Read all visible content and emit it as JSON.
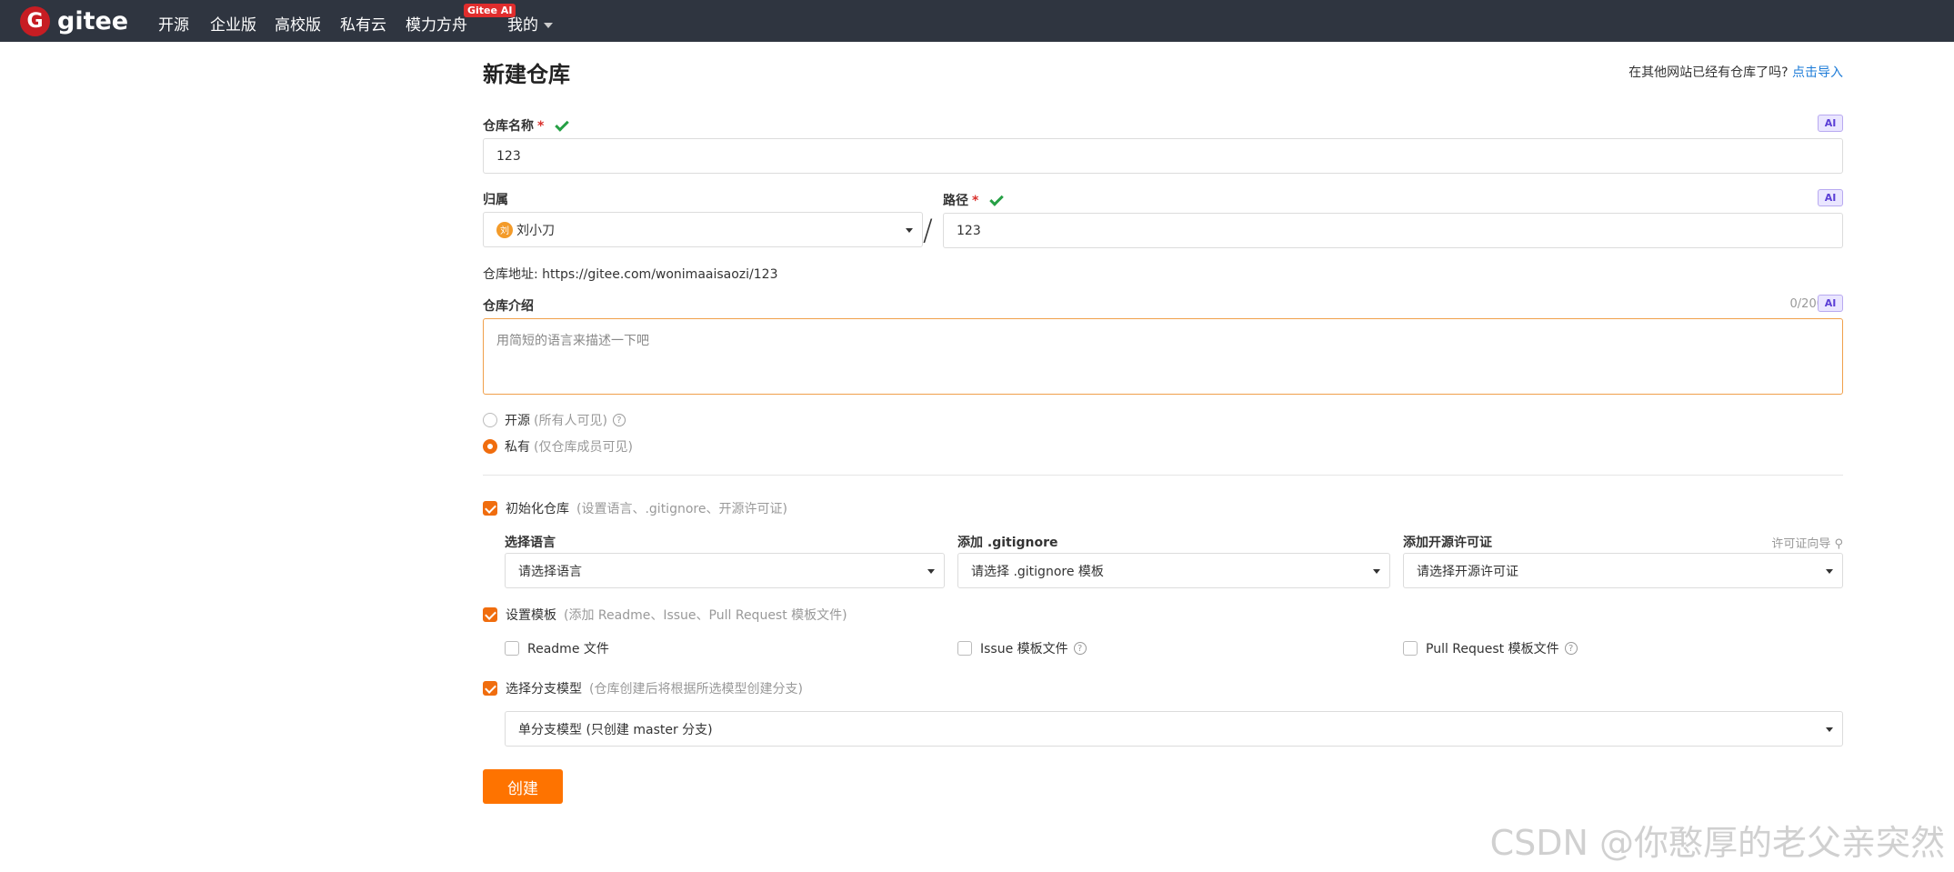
{
  "navbar": {
    "logo_glyph": "G",
    "logo_text": "gitee",
    "links": [
      "开源",
      "企业版",
      "高校版",
      "私有云",
      "模力方舟"
    ],
    "badge": "Gitee AI",
    "mine": "我的"
  },
  "page": {
    "title": "新建仓库",
    "import_prefix": "在其他网站已经有仓库了吗?",
    "import_link": "点击导入"
  },
  "repo_name": {
    "label": "仓库名称",
    "required": "*",
    "value": "123",
    "ai": "AI"
  },
  "owner": {
    "label": "归属",
    "avatar": "刘",
    "value": "刘小刀"
  },
  "path": {
    "label": "路径",
    "required": "*",
    "value": "123",
    "ai": "AI"
  },
  "slash": "/",
  "address": "仓库地址: https://gitee.com/wonimaaisaozi/123",
  "intro": {
    "label": "仓库介绍",
    "counter": "0/200",
    "ai": "AI",
    "placeholder": "用简短的语言来描述一下吧"
  },
  "visibility": {
    "public_label": "开源",
    "public_hint": "(所有人可见)",
    "private_label": "私有",
    "private_hint": "(仅仓库成员可见)",
    "help": "?"
  },
  "init": {
    "label": "初始化仓库",
    "hint": "(设置语言、.gitignore、开源许可证)",
    "language_label": "选择语言",
    "language_value": "请选择语言",
    "gitignore_label": "添加 .gitignore",
    "gitignore_value": "请选择 .gitignore 模板",
    "license_label": "添加开源许可证",
    "license_value": "请选择开源许可证",
    "license_guide": "许可证向导 ⚲"
  },
  "template": {
    "label": "设置模板",
    "hint": "(添加 Readme、Issue、Pull Request 模板文件)",
    "readme": "Readme 文件",
    "issue": "Issue 模板文件",
    "pr": "Pull Request 模板文件",
    "help": "?"
  },
  "branch": {
    "label": "选择分支模型",
    "hint": "(仓库创建后将根据所选模型创建分支)",
    "value": "单分支模型 (只创建 master 分支)"
  },
  "submit": "创建",
  "watermark": "CSDN @你憨厚的老父亲突然"
}
